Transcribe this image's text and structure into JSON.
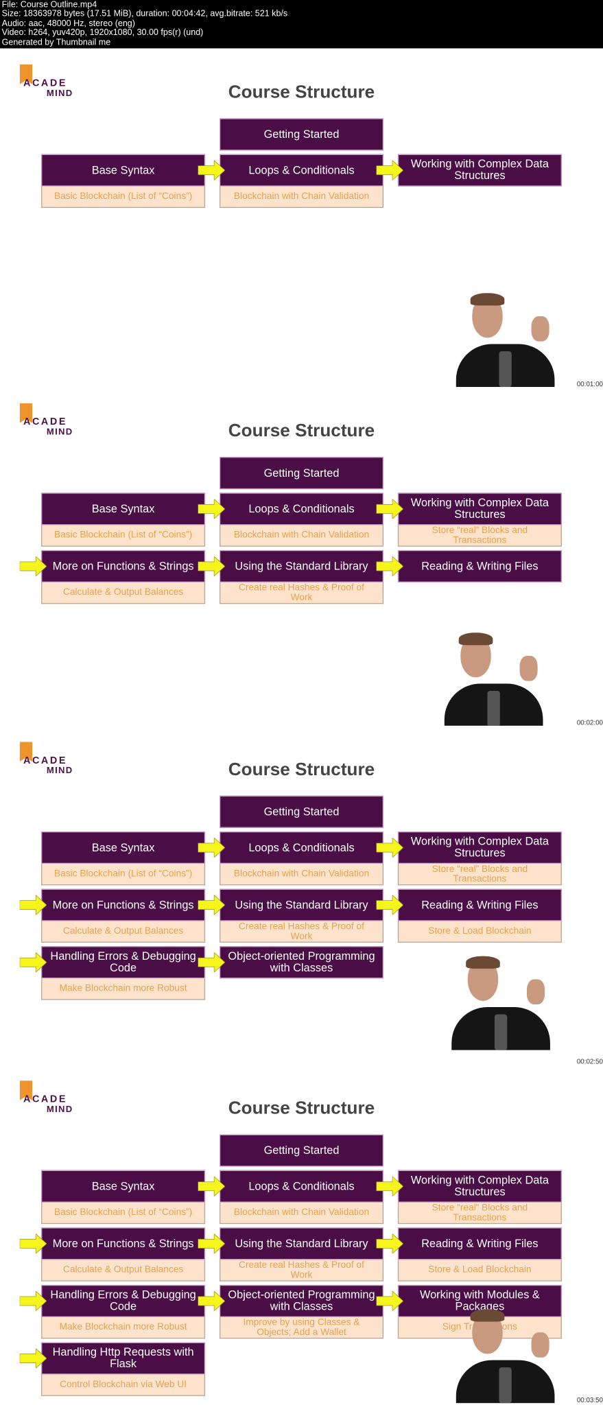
{
  "header": {
    "lines": [
      "File: Course Outline.mp4",
      "Size: 18363978 bytes (17.51 MiB), duration: 00:04:42, avg.bitrate: 521 kb/s",
      "Audio: aac, 48000 Hz, stereo (eng)",
      "Video: h264, yuv420p, 1920x1080, 30.00 fps(r) (und)",
      "Generated by Thumbnail me"
    ]
  },
  "logo": {
    "line1": "ACADE",
    "line2": "MIND",
    "colors": {
      "bookmark": "#f0932b",
      "text": "#4a1047"
    }
  },
  "colors": {
    "module": "#4a0d45",
    "project": "#fde3cc",
    "project_text": "#e5a24f",
    "arrow": "#f5f51c"
  },
  "frames": [
    {
      "title": "Course Structure",
      "timestamp": "00:01:00",
      "rows": [
        [
          {
            "title": "Getting Started"
          }
        ],
        [
          {
            "title": "Base Syntax",
            "sub": "Basic Blockchain (List of “Coins”)"
          },
          {
            "title": "Loops & Conditionals",
            "sub": "Blockchain with Chain Validation",
            "arrow": true
          },
          {
            "title": "Working with Complex Data Structures",
            "arrow": true
          }
        ]
      ]
    },
    {
      "title": "Course Structure",
      "timestamp": "00:02:00",
      "rows": [
        [
          {
            "title": "Getting Started"
          }
        ],
        [
          {
            "title": "Base Syntax",
            "sub": "Basic Blockchain (List of “Coins”)"
          },
          {
            "title": "Loops & Conditionals",
            "sub": "Blockchain with Chain Validation",
            "arrow": true
          },
          {
            "title": "Working with Complex Data Structures",
            "sub": "Store “real” Blocks and Transactions",
            "arrow": true
          }
        ],
        [
          {
            "title": "More on Functions & Strings",
            "sub": "Calculate & Output Balances",
            "arrow": true
          },
          {
            "title": "Using the Standard Library",
            "sub": "Create real Hashes & Proof of Work",
            "arrow": true
          },
          {
            "title": "Reading & Writing Files",
            "arrow": true
          }
        ]
      ]
    },
    {
      "title": "Course Structure",
      "timestamp": "00:02:50",
      "rows": [
        [
          {
            "title": "Getting Started"
          }
        ],
        [
          {
            "title": "Base Syntax",
            "sub": "Basic Blockchain (List of “Coins”)"
          },
          {
            "title": "Loops & Conditionals",
            "sub": "Blockchain with Chain Validation",
            "arrow": true
          },
          {
            "title": "Working with Complex Data Structures",
            "sub": "Store “real” Blocks and Transactions",
            "arrow": true
          }
        ],
        [
          {
            "title": "More on Functions & Strings",
            "sub": "Calculate & Output Balances",
            "arrow": true
          },
          {
            "title": "Using the Standard Library",
            "sub": "Create real Hashes & Proof of Work",
            "arrow": true
          },
          {
            "title": "Reading & Writing Files",
            "sub": "Store & Load Blockchain",
            "arrow": true
          }
        ],
        [
          {
            "title": "Handling Errors & Debugging Code",
            "sub": "Make Blockchain more Robust",
            "arrow": true
          },
          {
            "title": "Object-oriented Programming with Classes",
            "arrow": true
          }
        ]
      ]
    },
    {
      "title": "Course Structure",
      "timestamp": "00:03:50",
      "rows": [
        [
          {
            "title": "Getting Started"
          }
        ],
        [
          {
            "title": "Base Syntax",
            "sub": "Basic Blockchain (List of “Coins”)"
          },
          {
            "title": "Loops & Conditionals",
            "sub": "Blockchain with Chain Validation",
            "arrow": true
          },
          {
            "title": "Working with Complex Data Structures",
            "sub": "Store “real” Blocks and Transactions",
            "arrow": true
          }
        ],
        [
          {
            "title": "More on Functions & Strings",
            "sub": "Calculate & Output Balances",
            "arrow": true
          },
          {
            "title": "Using the Standard Library",
            "sub": "Create real Hashes & Proof of Work",
            "arrow": true
          },
          {
            "title": "Reading & Writing Files",
            "sub": "Store & Load Blockchain",
            "arrow": true
          }
        ],
        [
          {
            "title": "Handling Errors & Debugging Code",
            "sub": "Make Blockchain more Robust",
            "arrow": true
          },
          {
            "title": "Object-oriented Programming with Classes",
            "sub": "Improve by using Classes & Objects; Add a Wallet",
            "arrow": true
          },
          {
            "title": "Working with Modules & Packages",
            "sub": "Sign Transactions",
            "arrow": true
          }
        ],
        [
          {
            "title": "Handling Http Requests with Flask",
            "sub": "Control Blockchain via Web UI",
            "arrow": true
          }
        ]
      ]
    }
  ]
}
